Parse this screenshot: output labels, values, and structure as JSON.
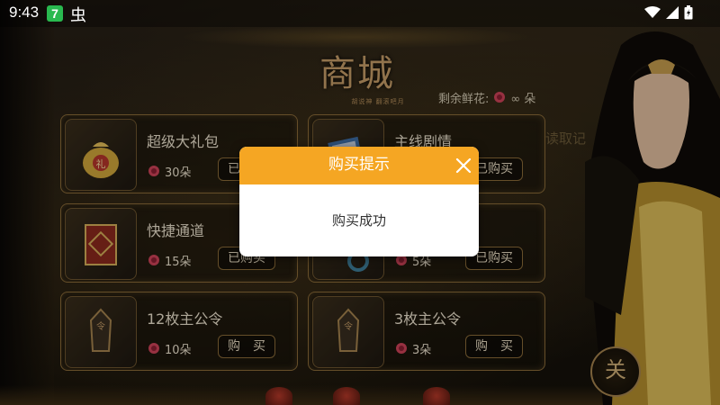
{
  "status_bar": {
    "time": "9:43",
    "badge": "7",
    "bug_glyph": "虫"
  },
  "shop": {
    "title": "商城",
    "subtitle": "胡说神 翻滚吧月",
    "flowers_label": "剩余鲜花:",
    "flowers_value": "∞ 朵"
  },
  "side_tab": "读取记",
  "items": [
    {
      "name": "超级大礼包",
      "price": "30朵",
      "button": "已购买",
      "icon": "gift-bag-icon"
    },
    {
      "name": "主线剧情",
      "price": "",
      "button": "已购买",
      "icon": "book-icon"
    },
    {
      "name": "快捷通道",
      "price": "15朵",
      "button": "已购买",
      "icon": "red-box-icon"
    },
    {
      "name": "",
      "price": "5朵",
      "button": "已购买",
      "icon": "jade-icon"
    },
    {
      "name": "12枚主公令",
      "price": "10朵",
      "button": "购　买",
      "icon": "token-icon"
    },
    {
      "name": "3枚主公令",
      "price": "3朵",
      "button": "购　买",
      "icon": "token-icon"
    }
  ],
  "close_seal": "关",
  "dialog": {
    "title": "购买提示",
    "message": "购买成功"
  },
  "colors": {
    "dialog_header": "#f5a623",
    "card_border": "#8c6d3a",
    "flower": "#d2445a"
  }
}
